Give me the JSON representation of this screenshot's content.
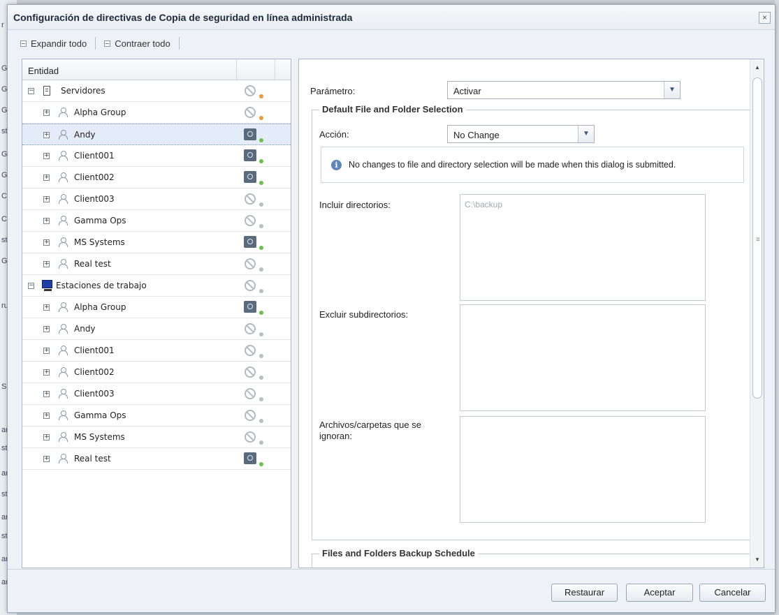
{
  "dialog": {
    "title": "Configuración de directivas de Copia de seguridad en línea administrada",
    "close_glyph": "×"
  },
  "toolbar": {
    "expand_label": "Expandir todo",
    "collapse_label": "Contraer todo"
  },
  "tree": {
    "column_entity": "Entidad",
    "groups": [
      {
        "label": "Servidores",
        "icon": "server-icon",
        "status": "disabled",
        "dot_color": "#e69a3b",
        "children": [
          {
            "label": "Alpha Group",
            "status": "disabled",
            "dot_color": "#e69a3b"
          },
          {
            "label": "Andy",
            "status": "active",
            "dot_color": "#6cbf4a",
            "selected": true
          },
          {
            "label": "Client001",
            "status": "active",
            "dot_color": "#6cbf4a"
          },
          {
            "label": "Client002",
            "status": "active",
            "dot_color": "#6cbf4a"
          },
          {
            "label": "Client003",
            "status": "disabled",
            "dot_color": "#b9bec5"
          },
          {
            "label": "Gamma Ops",
            "status": "disabled",
            "dot_color": "#b9bec5"
          },
          {
            "label": "MS Systems",
            "status": "active",
            "dot_color": "#6cbf4a"
          },
          {
            "label": "Real test",
            "status": "disabled",
            "dot_color": "#b9bec5"
          }
        ]
      },
      {
        "label": "Estaciones de trabajo",
        "icon": "workstation-icon",
        "status": "disabled",
        "dot_color": "#b9bec5",
        "children": [
          {
            "label": "Alpha Group",
            "status": "active",
            "dot_color": "#6cbf4a"
          },
          {
            "label": "Andy",
            "status": "disabled",
            "dot_color": "#b9bec5"
          },
          {
            "label": "Client001",
            "status": "disabled",
            "dot_color": "#b9bec5"
          },
          {
            "label": "Client002",
            "status": "disabled",
            "dot_color": "#b9bec5"
          },
          {
            "label": "Client003",
            "status": "disabled",
            "dot_color": "#b9bec5"
          },
          {
            "label": "Gamma Ops",
            "status": "disabled",
            "dot_color": "#b9bec5"
          },
          {
            "label": "MS Systems",
            "status": "disabled",
            "dot_color": "#b9bec5"
          },
          {
            "label": "Real test",
            "status": "active",
            "dot_color": "#6cbf4a"
          }
        ]
      }
    ]
  },
  "form": {
    "parameter_label": "Parámetro:",
    "parameter_value": "Activar",
    "section_default": "Default File and Folder Selection",
    "action_label": "Acción:",
    "action_value": "No Change",
    "info_text": "No changes to file and directory selection will be made when this dialog is submitted.",
    "include_label": "Incluir directorios:",
    "include_value": "C:\\backup",
    "exclude_label": "Excluir subdirectorios:",
    "ignored_label": "Archivos/carpetas que se ignoran:",
    "section_schedule": "Files and Folders Backup Schedule"
  },
  "buttons": {
    "restore": "Restaurar",
    "accept": "Aceptar",
    "cancel": "Cancelar"
  },
  "background_app": {
    "fragments": [
      "r",
      "Gr",
      "Gr",
      "Gr",
      "st",
      "Gr",
      "Gr",
      "C",
      "C",
      "st",
      "Gr",
      "ru",
      "S",
      "ar",
      "st",
      "ar",
      "st",
      "ar",
      "st",
      "ar",
      "ar"
    ]
  }
}
